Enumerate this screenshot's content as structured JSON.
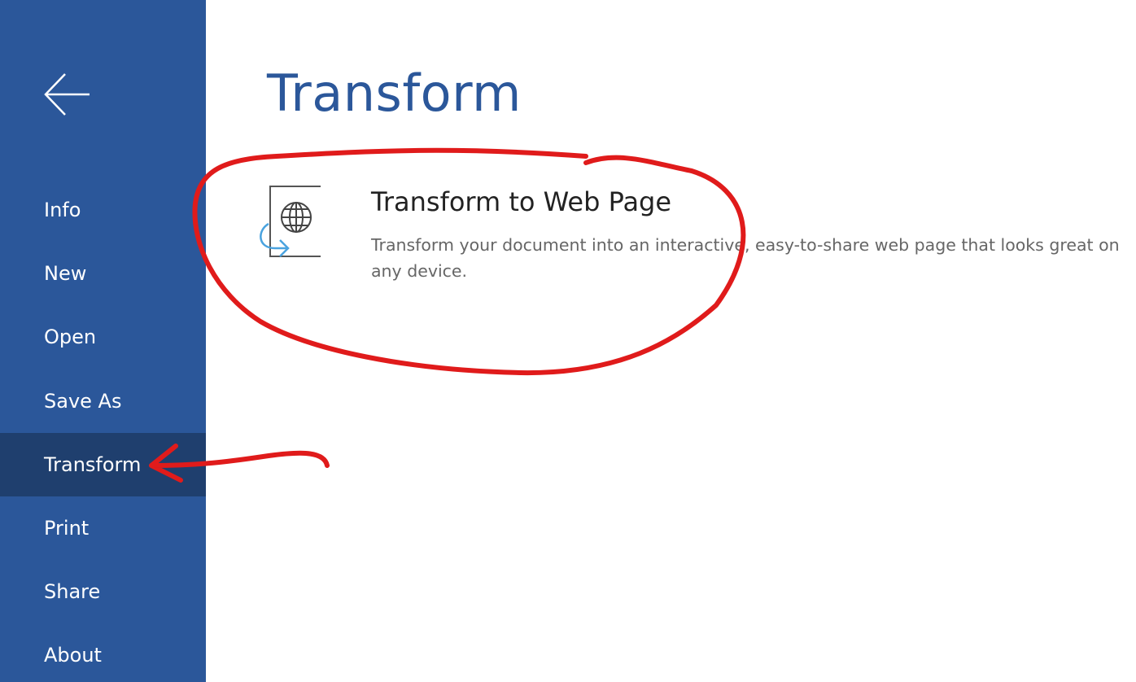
{
  "sidebar": {
    "back_icon": "back-arrow-icon",
    "items": [
      {
        "label": "Info",
        "active": false
      },
      {
        "label": "New",
        "active": false
      },
      {
        "label": "Open",
        "active": false
      },
      {
        "label": "Save As",
        "active": false
      },
      {
        "label": "Transform",
        "active": true
      },
      {
        "label": "Print",
        "active": false
      },
      {
        "label": "Share",
        "active": false
      },
      {
        "label": "About",
        "active": false
      }
    ]
  },
  "main": {
    "title": "Transform",
    "option": {
      "icon": "web-page-globe-icon",
      "title": "Transform to Web Page",
      "description": "Transform your document into an interactive, easy-to-share web page that looks great on any device."
    }
  },
  "annotations": {
    "circle_icon": "red-circle-annotation",
    "arrow_icon": "red-arrow-annotation"
  },
  "colors": {
    "sidebar_bg": "#2b579a",
    "sidebar_active_bg": "#1f3f6e",
    "title_color": "#2b579a",
    "annotation_red": "#e01b1b",
    "icon_accent": "#4aa3df"
  }
}
